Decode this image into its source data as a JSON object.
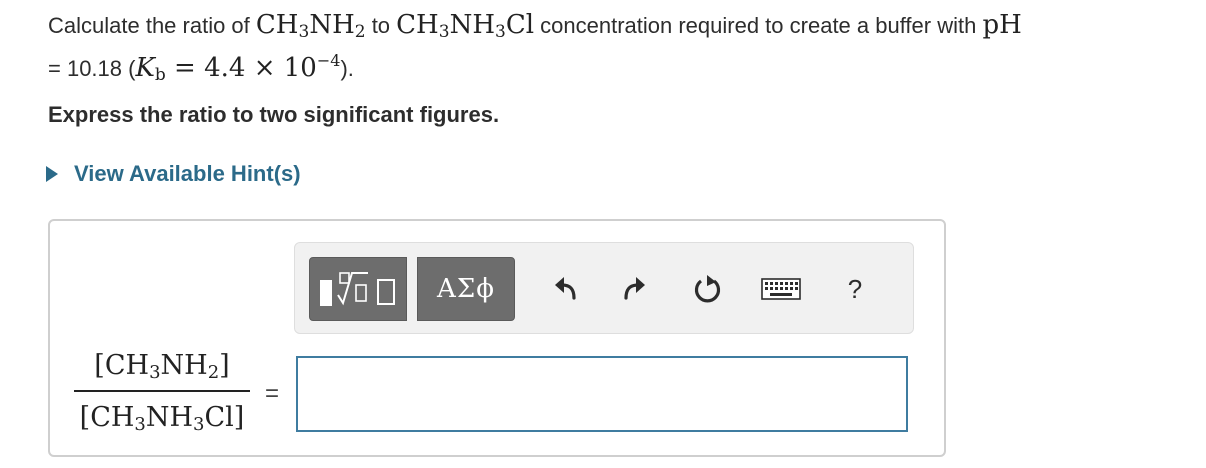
{
  "question": {
    "text_1": "Calculate the ratio of ",
    "base": {
      "pre": "CH",
      "s1": "3",
      "mid": "NH",
      "s2": "2"
    },
    "text_2": " to ",
    "salt": {
      "pre": "CH",
      "s1": "3",
      "mid": "NH",
      "s2": "3",
      "post": "Cl"
    },
    "text_3": " concentration required to create a buffer with ",
    "ph_symbol": "pH",
    "text_4": "= 10.18 (",
    "kb": {
      "K": "K",
      "sub": "b",
      "eq": " = 4.4 × 10",
      "exp": "−4"
    },
    "text_5": ")."
  },
  "instruction": "Express the ratio to two significant figures.",
  "hint": {
    "label": "View Available Hint(s)"
  },
  "toolbar": {
    "greek_label": "ΑΣϕ",
    "help_label": "?",
    "icons": [
      "templates-icon",
      "greek-symbols-icon",
      "undo-icon",
      "redo-icon",
      "reset-icon",
      "keyboard-icon",
      "help-icon"
    ]
  },
  "fraction": {
    "numerator": {
      "open": "[",
      "pre": "CH",
      "s1": "3",
      "mid": "NH",
      "s2": "2",
      "close": "]"
    },
    "denominator": {
      "open": "[",
      "pre": "CH",
      "s1": "3",
      "mid": "NH",
      "s2": "3",
      "post": "Cl",
      "close": "]"
    }
  },
  "equals_sign": "=",
  "answer": {
    "value": "",
    "placeholder": ""
  },
  "colors": {
    "link": "#2b6a89",
    "toolbar_button": "#6d6d6d",
    "input_border": "#3f7ca0",
    "panel_border": "#cfcfcf"
  }
}
